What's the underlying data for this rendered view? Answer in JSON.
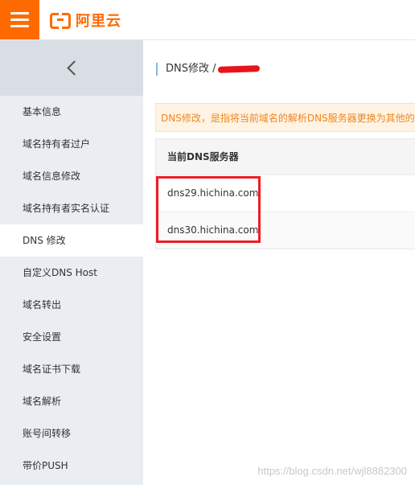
{
  "header": {
    "logo_text": "阿里云"
  },
  "sidebar": {
    "items": [
      {
        "label": "基本信息",
        "active": false
      },
      {
        "label": "域名持有者过户",
        "active": false
      },
      {
        "label": "域名信息修改",
        "active": false
      },
      {
        "label": "域名持有者实名认证",
        "active": false
      },
      {
        "label": "DNS 修改",
        "active": true
      },
      {
        "label": "自定义DNS Host",
        "active": false
      },
      {
        "label": "域名转出",
        "active": false
      },
      {
        "label": "安全设置",
        "active": false
      },
      {
        "label": "域名证书下载",
        "active": false
      },
      {
        "label": "域名解析",
        "active": false
      },
      {
        "label": "账号间转移",
        "active": false
      },
      {
        "label": "带价PUSH",
        "active": false
      }
    ]
  },
  "main": {
    "breadcrumb": "DNS修改 /",
    "notice": "DNS修改，是指将当前域名的解析DNS服务器更换为其他的DNS服务器",
    "table": {
      "header": "当前DNS服务器",
      "rows": [
        "dns29.hichina.com",
        "dns30.hichina.com"
      ]
    }
  },
  "watermark": "https://blog.csdn.net/wjl8882300",
  "colors": {
    "brand": "#ff6a00",
    "highlight": "#ee1c25",
    "notice_text": "#f0861f"
  }
}
